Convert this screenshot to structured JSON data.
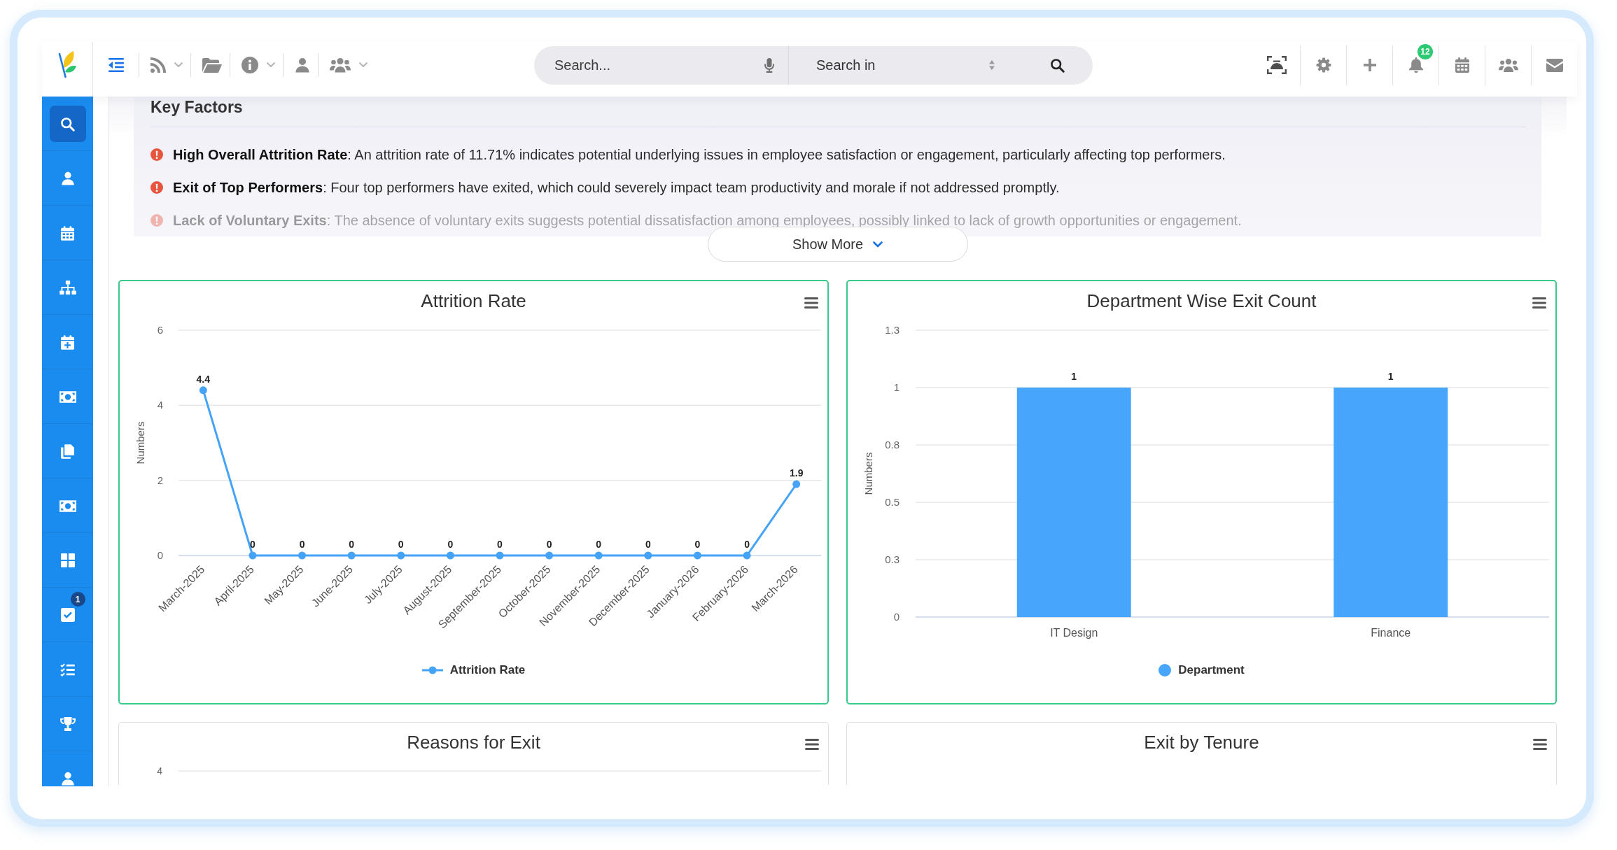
{
  "topbar": {
    "left_tools": [
      {
        "dropdown": false
      },
      {
        "dropdown": true
      },
      {
        "dropdown": false
      },
      {
        "dropdown": true
      },
      {
        "dropdown": false
      },
      {
        "dropdown": true
      }
    ],
    "search": {
      "placeholder": "Search...",
      "scope": "Search in"
    },
    "notifications": "12"
  },
  "sidebar": {
    "items": [
      {
        "selected": true
      },
      {
        "selected": false
      },
      {
        "selected": false
      },
      {
        "selected": false
      },
      {
        "selected": false
      },
      {
        "selected": false
      },
      {
        "selected": false
      },
      {
        "selected": false
      },
      {
        "selected": false
      },
      {
        "selected": false,
        "badge": "1"
      },
      {
        "selected": false
      },
      {
        "selected": false
      },
      {
        "selected": false
      }
    ]
  },
  "key_factors": {
    "title": "Key Factors",
    "expanded": false,
    "items": [
      {
        "text": "**High Overall Attrition Rate**: An attrition rate of 11.71% indicates potential underlying issues in employee satisfaction or engagement, particularly affecting top performers."
      },
      {
        "text": "**Exit of Top Performers**: Four top performers have exited, which could severely impact team productivity and morale if not addressed promptly."
      },
      {
        "text": "**Lack of Voluntary Exits**: The absence of voluntary exits suggests potential dissatisfaction among employees, possibly linked to lack of growth opportunities or engagement."
      }
    ],
    "toggle_label": "Show More"
  },
  "charts": [
    {
      "chart_data": {
        "type": "line",
        "title": "Attrition Rate",
        "ylabel": "Numbers",
        "categories": [
          "March-2025",
          "April-2025",
          "May-2025",
          "June-2025",
          "July-2025",
          "August-2025",
          "September-2025",
          "October-2025",
          "November-2025",
          "December-2025",
          "January-2026",
          "February-2026",
          "March-2026"
        ],
        "series": [
          {
            "name": "Attrition Rate",
            "color": "#45a3f7",
            "marker": "circle",
            "values": [
              4.4,
              0,
              0,
              0,
              0,
              0,
              0,
              0,
              0,
              0,
              0,
              0,
              1.9
            ]
          }
        ],
        "ylim": [
          0,
          6
        ],
        "yticks": [
          0,
          2,
          4,
          6
        ],
        "grid": true,
        "data_labels": true
      }
    },
    {
      "chart_data": {
        "type": "bar",
        "title": "Department Wise Exit Count",
        "ylabel": "Numbers",
        "categories": [
          "IT Design",
          "Finance"
        ],
        "series": [
          {
            "name": "Department",
            "color": "#47a5fb",
            "values": [
              1,
              1
            ]
          }
        ],
        "ylim": [
          0,
          1.25
        ],
        "yticks": [
          {
            "value": 0,
            "label": "0"
          },
          {
            "value": 0.25,
            "label": "0.3"
          },
          {
            "value": 0.5,
            "label": "0.5"
          },
          {
            "value": 0.75,
            "label": "0.8"
          },
          {
            "value": 1,
            "label": "1"
          },
          {
            "value": 1.25,
            "label": "1.3"
          }
        ],
        "grid": true,
        "data_labels": true
      }
    }
  ],
  "more_charts": [
    {
      "title": "Reasons for Exit",
      "axis_labels": [
        "4"
      ]
    },
    {
      "title": "Exit by Tenure"
    }
  ]
}
